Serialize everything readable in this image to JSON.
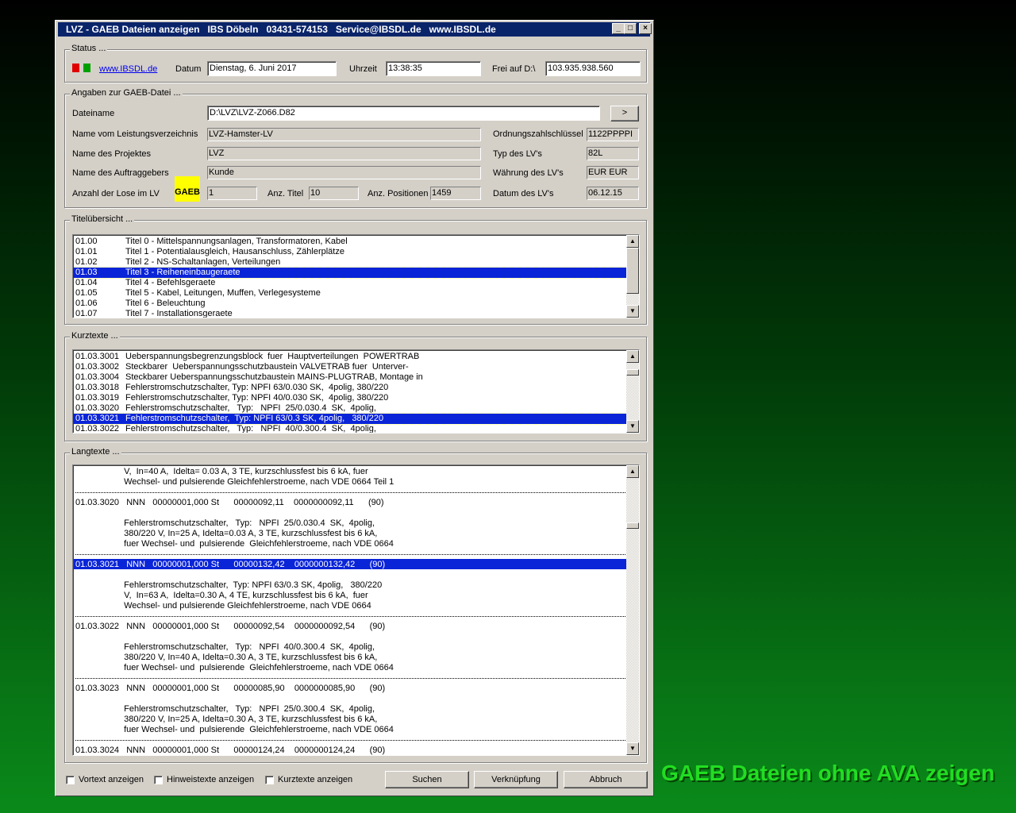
{
  "window": {
    "title": "LVZ - GAEB Dateien anzeigen   IBS Döbeln   03431-574153   Service@IBSDL.de   www.IBSDL.de",
    "btn_min": "_",
    "btn_max": "□",
    "btn_close": "×"
  },
  "status": {
    "group_label": "Status ...",
    "link": "www.IBSDL.de",
    "datum_label": "Datum",
    "datum": "Dienstag, 6. Juni 2017",
    "uhrzeit_label": "Uhrzeit",
    "uhrzeit": "13:38:35",
    "frei_label": "Frei auf D:\\",
    "frei": "103.935.938.560",
    "colors": {
      "red": "#e00000",
      "green": "#00a000"
    }
  },
  "gaeb": {
    "group_label": "Angaben zur GAEB-Datei ...",
    "dateiname_label": "Dateiname",
    "dateiname": "D:\\LVZ\\LVZ-Z066.D82",
    "browse_label": ">",
    "lv_name_label": "Name vom Leistungsverzeichnis",
    "lv_name": "LVZ-Hamster-LV",
    "projekt_label": "Name des Projektes",
    "projekt": "LVZ",
    "auftraggeber_label": "Name des Auftraggebers",
    "auftraggeber": "Kunde",
    "lose_label": "Anzahl der Lose im LV",
    "gaeb_badge": "GAEB",
    "lose": "1",
    "titel_label": "Anz. Titel",
    "titel": "10",
    "positionen_label": "Anz. Positionen",
    "positionen": "1459",
    "ozs_label": "Ordnungszahlschlüssel",
    "ozs": "1122PPPPI",
    "typ_label": "Typ des LV's",
    "typ": "82L",
    "waehrung_label": "Währung des LV's",
    "waehrung": "EUR   EUR",
    "datum_label": "Datum des LV's",
    "datum": "06.12.15"
  },
  "titel": {
    "group_label": "Titelübersicht ...",
    "items": [
      {
        "code": "01.00",
        "text": "Titel 0 - Mittelspannungsanlagen, Transformatoren, Kabel"
      },
      {
        "code": "01.01",
        "text": "Titel 1 - Potentialausgleich, Hausanschluss, Zählerplätze"
      },
      {
        "code": "01.02",
        "text": "Titel 2 - NS-Schaltanlagen, Verteilungen"
      },
      {
        "code": "01.03",
        "text": "Titel 3 - Reiheneinbaugeraete"
      },
      {
        "code": "01.04",
        "text": "Titel 4 - Befehlsgeraete"
      },
      {
        "code": "01.05",
        "text": "Titel 5 - Kabel, Leitungen, Muffen, Verlegesysteme"
      },
      {
        "code": "01.06",
        "text": "Titel 6 - Beleuchtung"
      },
      {
        "code": "01.07",
        "text": "Titel 7 - Installationsgeraete"
      }
    ]
  },
  "kurz": {
    "group_label": "Kurztexte ...",
    "items": [
      {
        "code": "01.03.3001",
        "text": "Ueberspannungsbegrenzungsblock  fuer  Hauptverteilungen  POWERTRAB"
      },
      {
        "code": "01.03.3002",
        "text": "Steckbarer  Ueberspannungsschutzbaustein VALVETRAB fuer  Unterver-"
      },
      {
        "code": "01.03.3004",
        "text": "Steckbarer Ueberspannungsschutzbaustein MAINS-PLUGTRAB, Montage in"
      },
      {
        "code": "01.03.3018",
        "text": "Fehlerstromschutzschalter, Typ: NPFI 63/0.030 SK,  4polig, 380/220"
      },
      {
        "code": "01.03.3019",
        "text": "Fehlerstromschutzschalter, Typ: NPFI 40/0.030 SK,  4polig, 380/220"
      },
      {
        "code": "01.03.3020",
        "text": "Fehlerstromschutzschalter,   Typ:   NPFI  25/0.030.4  SK,  4polig,"
      },
      {
        "code": "01.03.3021",
        "text": "Fehlerstromschutzschalter,  Typ: NPFI 63/0.3 SK, 4polig,   380/220"
      },
      {
        "code": "01.03.3022",
        "text": "Fehlerstromschutzschalter,   Typ:   NPFI  40/0.300.4  SK,  4polig,"
      }
    ]
  },
  "lang": {
    "group_label": "Langtexte ...",
    "lines": [
      "                    V,  In=40 A,  Idelta= 0.03 A, 3 TE, kurzschlussfest bis 6 kA, fuer",
      "                    Wechsel- und pulsierende Gleichfehlerstroeme, nach VDE 0664 Teil 1",
      "01.03.3020   NNN   00000001,000 St      00000092,11    0000000092,11      (90)",
      "                    Fehlerstromschutzschalter,   Typ:   NPFI  25/0.030.4  SK,  4polig,",
      "                    380/220 V, In=25 A, Idelta=0.03 A, 3 TE, kurzschlussfest bis 6 kA,",
      "                    fuer Wechsel- und  pulsierende  Gleichfehlerstroeme, nach VDE 0664",
      "01.03.3021   NNN   00000001,000 St      00000132,42    0000000132,42      (90)",
      "                    Fehlerstromschutzschalter,  Typ: NPFI 63/0.3 SK, 4polig,   380/220",
      "                    V,  In=63 A,  Idelta=0.30 A, 4 TE, kurzschlussfest bis 6 kA,  fuer",
      "                    Wechsel- und pulsierende Gleichfehlerstroeme, nach VDE 0664",
      "01.03.3022   NNN   00000001,000 St      00000092,54    0000000092,54      (90)",
      "                    Fehlerstromschutzschalter,   Typ:   NPFI  40/0.300.4  SK,  4polig,",
      "                    380/220 V, In=40 A, Idelta=0.30 A, 3 TE, kurzschlussfest bis 6 kA,",
      "                    fuer Wechsel- und  pulsierende  Gleichfehlerstroeme, nach VDE 0664",
      "01.03.3023   NNN   00000001,000 St      00000085,90    0000000085,90      (90)",
      "                    Fehlerstromschutzschalter,   Typ:   NPFI  25/0.300.4  SK,  4polig,",
      "                    380/220 V, In=25 A, Idelta=0.30 A, 3 TE, kurzschlussfest bis 6 kA,",
      "                    fuer Wechsel- und  pulsierende  Gleichfehlerstroeme, nach VDE 0664",
      "01.03.3024   NNN   00000001,000 St      00000124,24    0000000124,24      (90)"
    ]
  },
  "footer": {
    "vortext": "Vortext anzeigen",
    "hinweis": "Hinweistexte anzeigen",
    "kurztexte": "Kurztexte anzeigen",
    "suchen": "Suchen",
    "verknuepfung": "Verknüpfung",
    "abbruch": "Abbruch"
  },
  "tagline": "GAEB Dateien ohne AVA zeigen"
}
